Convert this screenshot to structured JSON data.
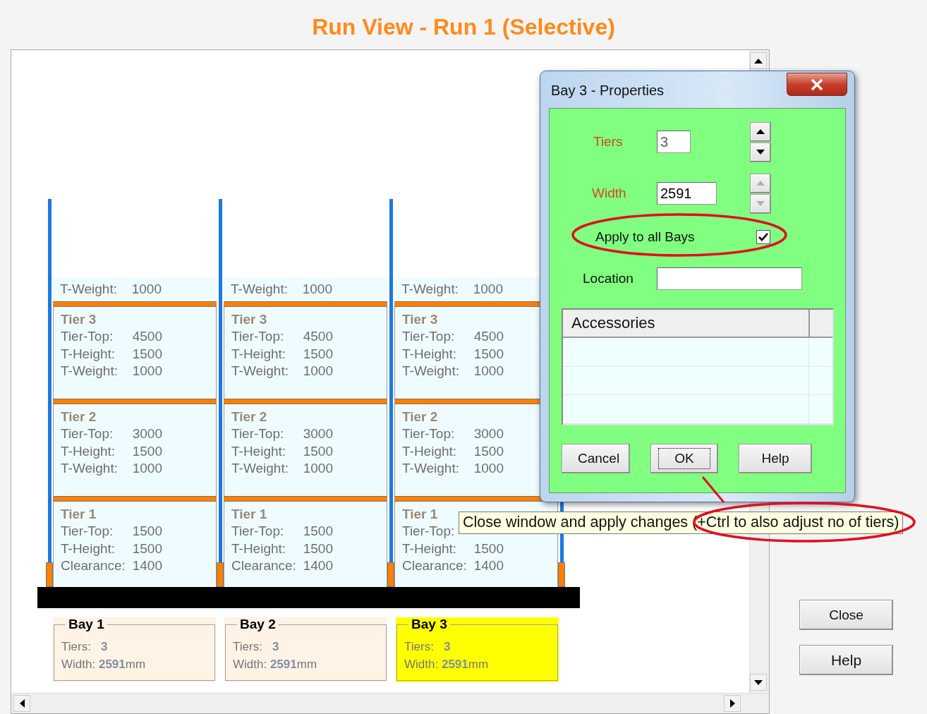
{
  "title": "Run View - Run 1 (Selective)",
  "bays": [
    {
      "name": "Bay 1",
      "selected": false,
      "top_weight": {
        "label": "T-Weight:",
        "value": "1000"
      },
      "tiers": [
        {
          "title": "Tier 3",
          "lines": [
            {
              "label": "Tier-Top:",
              "value": "4500"
            },
            {
              "label": "T-Height:",
              "value": "1500"
            },
            {
              "label": "T-Weight:",
              "value": "1000"
            }
          ]
        },
        {
          "title": "Tier 2",
          "lines": [
            {
              "label": "Tier-Top:",
              "value": "3000"
            },
            {
              "label": "T-Height:",
              "value": "1500"
            },
            {
              "label": "T-Weight:",
              "value": "1000"
            }
          ]
        },
        {
          "title": "Tier 1",
          "lines": [
            {
              "label": "Tier-Top:",
              "value": "1500"
            },
            {
              "label": "T-Height:",
              "value": "1500"
            },
            {
              "label": "Clearance:",
              "value": "1400"
            }
          ]
        }
      ],
      "summary": {
        "tiers_label": "Tiers:",
        "tiers_value": "3",
        "width_label": "Width:",
        "width_value": "2591",
        "width_unit": "mm"
      }
    },
    {
      "name": "Bay 2",
      "selected": false,
      "top_weight": {
        "label": "T-Weight:",
        "value": "1000"
      },
      "tiers": [
        {
          "title": "Tier 3",
          "lines": [
            {
              "label": "Tier-Top:",
              "value": "4500"
            },
            {
              "label": "T-Height:",
              "value": "1500"
            },
            {
              "label": "T-Weight:",
              "value": "1000"
            }
          ]
        },
        {
          "title": "Tier 2",
          "lines": [
            {
              "label": "Tier-Top:",
              "value": "3000"
            },
            {
              "label": "T-Height:",
              "value": "1500"
            },
            {
              "label": "T-Weight:",
              "value": "1000"
            }
          ]
        },
        {
          "title": "Tier 1",
          "lines": [
            {
              "label": "Tier-Top:",
              "value": "1500"
            },
            {
              "label": "T-Height:",
              "value": "1500"
            },
            {
              "label": "Clearance:",
              "value": "1400"
            }
          ]
        }
      ],
      "summary": {
        "tiers_label": "Tiers:",
        "tiers_value": "3",
        "width_label": "Width:",
        "width_value": "2591",
        "width_unit": "mm"
      }
    },
    {
      "name": "Bay 3",
      "selected": true,
      "top_weight": {
        "label": "T-Weight:",
        "value": "1000"
      },
      "tiers": [
        {
          "title": "Tier 3",
          "lines": [
            {
              "label": "Tier-Top:",
              "value": "4500"
            },
            {
              "label": "T-Height:",
              "value": "1500"
            },
            {
              "label": "T-Weight:",
              "value": "1000"
            }
          ]
        },
        {
          "title": "Tier 2",
          "lines": [
            {
              "label": "Tier-Top:",
              "value": "3000"
            },
            {
              "label": "T-Height:",
              "value": "1500"
            },
            {
              "label": "T-Weight:",
              "value": "1000"
            }
          ]
        },
        {
          "title": "Tier 1",
          "lines": [
            {
              "label": "Tier-Top:"
            },
            {
              "label": "T-Height:",
              "value": "1500"
            },
            {
              "label": "Clearance:",
              "value": "1400"
            }
          ]
        }
      ],
      "summary": {
        "tiers_label": "Tiers:",
        "tiers_value": "3",
        "width_label": "Width:",
        "width_value": "2591",
        "width_unit": "mm"
      }
    }
  ],
  "dialog": {
    "title": "Bay 3 - Properties",
    "spin_fields": [
      {
        "label": "Tiers",
        "value": "3",
        "field_disabled": true,
        "spin_disabled": false
      },
      {
        "label": "Width",
        "value": "2591",
        "field_disabled": false,
        "spin_disabled": true
      }
    ],
    "checkbox": {
      "label": "Apply to all Bays",
      "checked": true
    },
    "location": {
      "label": "Location"
    },
    "list": {
      "header": "Accessories"
    },
    "buttons": [
      {
        "label": "Cancel",
        "focused": false
      },
      {
        "label": "OK",
        "focused": true
      },
      {
        "label": "Help",
        "focused": false
      }
    ]
  },
  "tooltip": {
    "text": "Close window and apply changes (+Ctrl to also adjust no of tiers)"
  },
  "side_buttons": [
    "Close",
    "Help"
  ]
}
